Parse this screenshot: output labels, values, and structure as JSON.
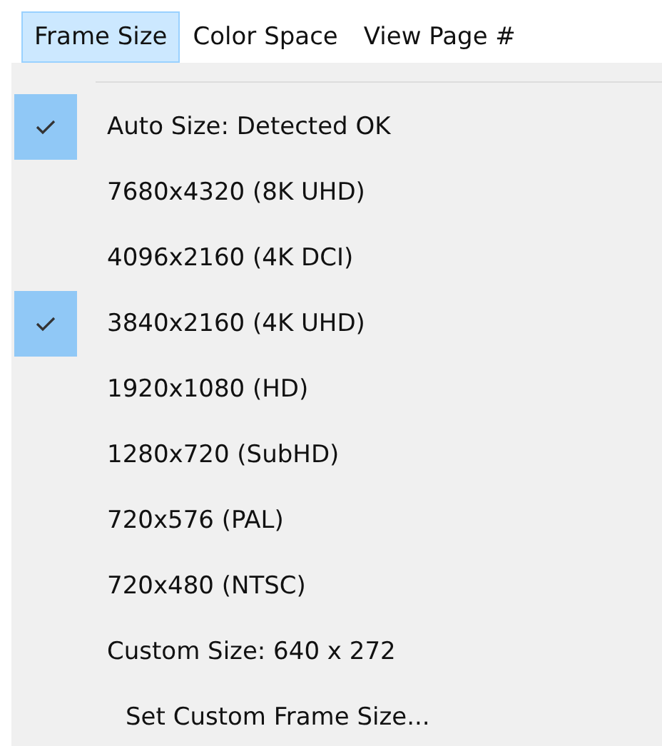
{
  "menu_bar": [
    {
      "label": "Frame Size",
      "selected": true
    },
    {
      "label": "Color Space",
      "selected": false
    },
    {
      "label": "View Page #",
      "selected": false
    }
  ],
  "menu": [
    {
      "kind": "option",
      "label": "Auto Size: Detected OK",
      "checked": true
    },
    {
      "kind": "option",
      "label": "7680x4320 (8K UHD)",
      "checked": false
    },
    {
      "kind": "option",
      "label": "4096x2160 (4K DCI)",
      "checked": false
    },
    {
      "kind": "option",
      "label": "3840x2160 (4K UHD)",
      "checked": true
    },
    {
      "kind": "option",
      "label": "1920x1080 (HD)",
      "checked": false
    },
    {
      "kind": "option",
      "label": "1280x720 (SubHD)",
      "checked": false
    },
    {
      "kind": "option",
      "label": "720x576 (PAL)",
      "checked": false
    },
    {
      "kind": "option",
      "label": "720x480 (NTSC)",
      "checked": false
    },
    {
      "kind": "option",
      "label": "Custom Size: 640 x 272",
      "checked": false
    },
    {
      "kind": "command",
      "label": "Set Custom Frame Size..."
    }
  ]
}
